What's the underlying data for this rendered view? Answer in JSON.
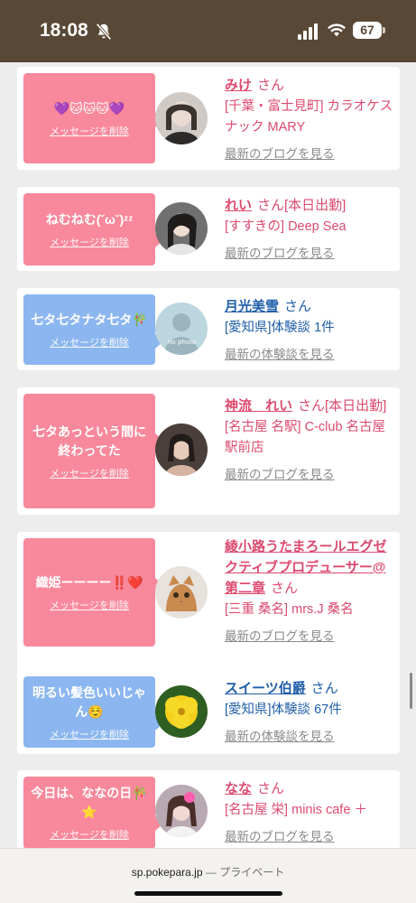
{
  "status": {
    "time": "18:08",
    "battery": "67"
  },
  "delete_label": "メッセージを削除",
  "entries": [
    {
      "message": "💜🐱🐱🐱💜",
      "name": "みけ",
      "san": "さん",
      "shop": "[千葉・富士見町] カラオケスナック MARY",
      "link": "最新のブログを見る"
    },
    {
      "message": "ねむねむ(˘ω˘)ᶻᶻ",
      "name": "れい",
      "san": "さん[本日出勤]",
      "shop": "[すすきの] Deep Sea",
      "link": "最新のブログを見る"
    },
    {
      "message": "七タ七タナタ七タ🎋",
      "name": "月光美雪",
      "san": "さん",
      "shop": "[愛知県]体験談 1件",
      "link": "最新の体験談を見る"
    },
    {
      "message": "七タあっという間に終わってた",
      "name": "神流　れい",
      "san": "さん[本日出勤]",
      "shop": "[名古屋 名駅] C-club 名古屋駅前店",
      "link": "最新のブログを見る"
    },
    {
      "message": "織姫ーーーー‼️❤️",
      "name": "綾小路うたまろールエグゼクティブプロデューサー@第二章",
      "san": "さん",
      "shop": "[三重 桑名] mrs.J 桑名",
      "link": "最新のブログを見る"
    },
    {
      "message": "明るい髪色いいじゃん☺️",
      "name": "スイーツ伯爵",
      "san": "さん",
      "shop": "[愛知県]体験談 67件",
      "link": "最新の体験談を見る"
    },
    {
      "message": "今日は、ななの日🎋⭐",
      "name": "なな",
      "san": "さん",
      "shop": "[名古屋 栄] minis cafe ＋",
      "link": "最新のブログを見る"
    }
  ],
  "browser": {
    "url": "sp.pokepara.jp",
    "separator": "—",
    "mode": "プライベート"
  },
  "colors": {
    "pink": "#f8889b",
    "blue": "#8cb6ef",
    "header": "#5a4836"
  }
}
